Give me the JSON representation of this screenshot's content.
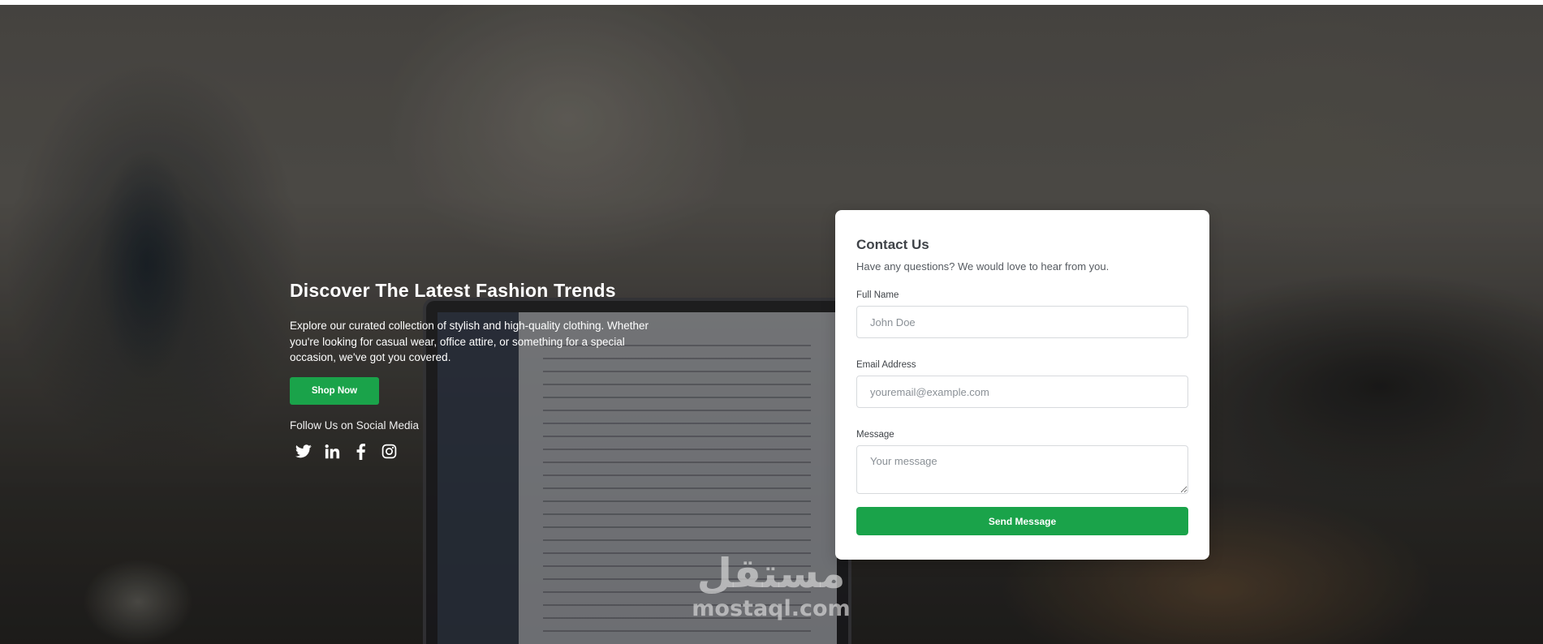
{
  "hero": {
    "title": "Discover The Latest Fashion Trends",
    "description": "Explore our curated collection of stylish and high-quality clothing. Whether you're looking for casual wear, office attire, or something for a special occasion, we've got you covered.",
    "cta_label": "Shop Now",
    "follow_label": "Follow Us on Social Media",
    "socials": [
      {
        "name": "twitter-icon"
      },
      {
        "name": "linkedin-icon"
      },
      {
        "name": "facebook-icon"
      },
      {
        "name": "instagram-icon"
      }
    ]
  },
  "contact": {
    "title": "Contact Us",
    "subtitle": "Have any questions? We would love to hear from you.",
    "full_name_label": "Full Name",
    "full_name_placeholder": "John Doe",
    "email_label": "Email Address",
    "email_placeholder": "youremail@example.com",
    "message_label": "Message",
    "message_placeholder": "Your message",
    "submit_label": "Send Message"
  },
  "watermark": {
    "arabic": "مستقل",
    "latin": "mostaql.com"
  },
  "colors": {
    "accent": "#1aa34a",
    "card_bg": "#ffffff",
    "text_dark": "#3f4348"
  }
}
